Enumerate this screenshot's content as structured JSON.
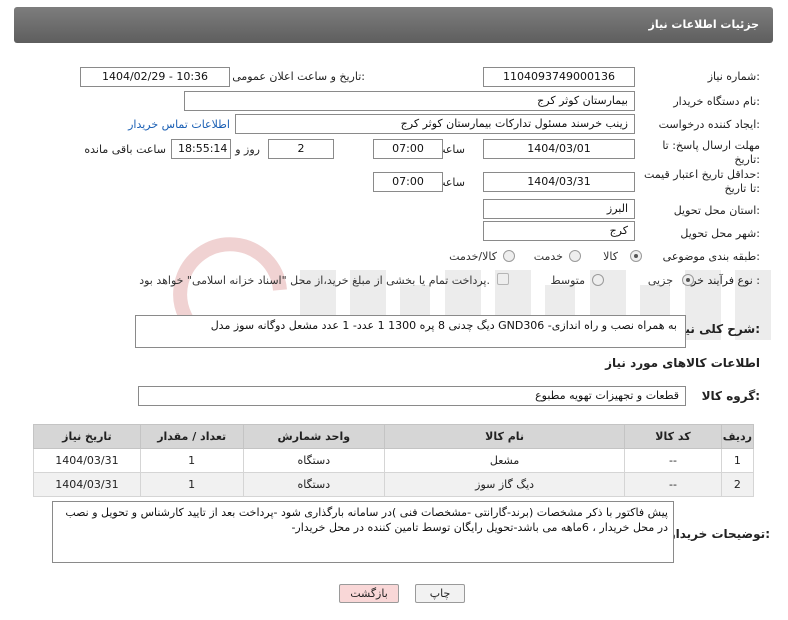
{
  "header": {
    "title": "جزئیات اطلاعات نیاز"
  },
  "labels": {
    "need_number": "شماره نیاز:",
    "announce_datetime": "تاریخ و ساعت اعلان عمومی:",
    "buyer_org": "نام دستگاه خریدار:",
    "creator": "ایجاد کننده درخواست:",
    "contact_link": "اطلاعات تماس خریدار",
    "reply_deadline_l1": "مهلت ارسال پاسخ: تا",
    "reply_deadline_l2": "تاریخ:",
    "validity_l1": "حداقل تاریخ اعتبار قیمت:",
    "validity_l2": "تا تاریخ:",
    "time": "ساعت",
    "day_and": "روز و",
    "remaining": "ساعت باقی مانده",
    "province": "استان محل تحویل:",
    "city": "شهر محل تحویل:",
    "category": "طبقه بندی موضوعی:",
    "process_type": "نوع فرآیند خرید :",
    "general_desc": "شرح کلی نیاز:",
    "items_info": "اطلاعات کالاهای مورد نیاز",
    "goods_group": "گروه کالا:",
    "buyer_notes": "توضیحات خریدار:"
  },
  "values": {
    "need_number": "1104093749000136",
    "announce_datetime": "1404/02/29 - 10:36",
    "buyer_org": "بیمارستان کوثر کرج",
    "creator": "زینب خرسند مسئول تدارکات بیمارستان کوثر کرج",
    "reply_date": "1404/03/01",
    "reply_time": "07:00",
    "days": "2",
    "remaining_time": "18:55:14",
    "validity_date": "1404/03/31",
    "validity_time": "07:00",
    "province": "البرز",
    "city": "کرج",
    "general_desc": "دیگ چدنی 8 پره 1300 1 عدد- 1 عدد مشعل دوگانه سوز مدل GND306 -به همراه نصب و راه اندازی",
    "goods_group": "قطعات و تجهیزات تهویه مطبوع",
    "buyer_notes": "پیش فاکتور با ذکر مشخصات (برند-گارانتی -مشخصات فنی )در سامانه بارگذاری شود -پرداخت بعد از تایید کارشناس و تحویل و نصب  در محل خریدار ، 6ماهه می باشد-تحویل رایگان توسط تامین کننده در محل خریدار-"
  },
  "category_options": [
    {
      "label": "کالا",
      "selected": true
    },
    {
      "label": "خدمت",
      "selected": false
    },
    {
      "label": "کالا/خدمت",
      "selected": false
    }
  ],
  "process_options": [
    {
      "label": "جزیی",
      "selected": true
    },
    {
      "label": "متوسط",
      "selected": false
    }
  ],
  "payment_note": "پرداخت تمام یا بخشی از مبلغ خرید،از محل \"اسناد خزانه اسلامی\" خواهد بود.",
  "table": {
    "headers": [
      "ردیف",
      "کد کالا",
      "نام کالا",
      "واحد شمارش",
      "تعداد / مقدار",
      "تاریخ نیاز"
    ],
    "rows": [
      [
        "1",
        "--",
        "مشعل",
        "دستگاه",
        "1",
        "1404/03/31"
      ],
      [
        "2",
        "--",
        "دیگ گاز سوز",
        "دستگاه",
        "1",
        "1404/03/31"
      ]
    ]
  },
  "buttons": {
    "print": "چاپ",
    "back": "بازگشت"
  },
  "colors": {
    "header_bg": "#6e6e6e",
    "link": "#1a5fb4",
    "back_button_bg": "#f9d7d7",
    "print_button_bg": "#f2f2f2"
  }
}
